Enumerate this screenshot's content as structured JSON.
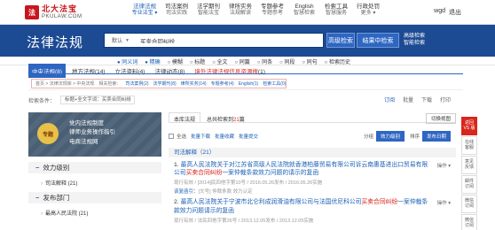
{
  "logo": {
    "mark": "法",
    "cn": "北大法宝",
    "en": "PKULAW.COM"
  },
  "nav": [
    {
      "label": "法律法规",
      "sub": "专业法宝 ▾",
      "active": true
    },
    {
      "label": "司法案例",
      "sub": "司法实践",
      "active": false
    },
    {
      "label": "法学期刊",
      "sub": "智能法宝",
      "active": false
    },
    {
      "label": "律所实务",
      "sub": "法规解读",
      "active": false
    },
    {
      "label": "专题参考",
      "sub": "专题参考",
      "active": false
    },
    {
      "label": "English",
      "sub": "智慧检索",
      "active": false
    },
    {
      "label": "检索工具",
      "sub": "智慧服务",
      "active": false
    },
    {
      "label": "行政处罚",
      "sub": "更多 ▾",
      "active": false
    }
  ],
  "user": "wgd",
  "logout": "退出",
  "banner": {
    "title": "法律法规",
    "scope": "默认",
    "query": "买卖合同纠纷",
    "search_btn": "高级检索",
    "insearch_btn": "结果中检索",
    "adv1": "高级检索",
    "adv2": "智能检索"
  },
  "subnav": [
    "● 同义词",
    "● 精确",
    "○ 模糊",
    "○ 标题",
    "○ 全文",
    "○ 同篇",
    "○ 同条",
    "○ 同段",
    "○ 同句",
    "○ 检索历史"
  ],
  "cats": [
    {
      "label": "中央法规",
      "count": "(8)",
      "on": true
    },
    {
      "label": "地方法规",
      "count": "(14)",
      "on": false
    },
    {
      "label": "立法资料",
      "count": "(4)",
      "on": false
    },
    {
      "label": "法律动态",
      "count": "(8)",
      "on": false
    },
    {
      "label": "境外法律法规信息资源搜",
      "count": "(1)",
      "on": false
    }
  ],
  "filter": {
    "crumb": "首页 > 法律法规库 > 中央法规",
    "related": "相关检索：",
    "links": [
      "司法案例(2)",
      "法学期刊(8)",
      "律所实务(14)",
      "专题参考(4)",
      "English(1)",
      "检索工具(0)"
    ]
  },
  "tools": [
    "订阅",
    "批量",
    "下载",
    "打印"
  ],
  "cond": {
    "label": "检索条件：",
    "value": "标题+全文字词：买卖合同纠纷",
    "clear": "×"
  },
  "promo": {
    "badge": "专题",
    "lines": [
      "党内法规制度",
      "律师业务操作指引",
      "电商法规网"
    ]
  },
  "sidebar": [
    {
      "head": "效力级别",
      "items": [
        "司法解释 (21)"
      ]
    },
    {
      "head": "发布部门",
      "items": [
        "最高人民法院 (21)"
      ]
    }
  ],
  "main": {
    "tab1": "本库法规",
    "tab2_prefix": "总共检索到",
    "tab2_count": "21",
    "tab2_suffix": "篇",
    "switch": "切换视图",
    "ops": [
      "全选",
      "批量下载",
      "批量收藏",
      "批量提交"
    ],
    "ops_right_label": "分组",
    "ops_pill1": "效力级别",
    "ops_sort": "排序",
    "ops_pill2": "发布日期",
    "group_label": "司法解释（21）",
    "items": [
      {
        "num": "1.",
        "text_a": "最高人民法院关于对江苏省高级人民法院就香港柏藤贸易有限公司诉云南惠基进出口贸易有限公司",
        "hl": "买卖合同纠纷",
        "text_b": "一案仲裁条款效力问题的请示的复函",
        "meta": "现行有效 / [2014]民四他字第10号 / 2016.05.26发布 / 2016.05.26实施",
        "rel": "该复函引：",
        "rel_b": "[文号] 仲裁条款 效力认定",
        "ops": "操作 ▾"
      },
      {
        "num": "2.",
        "text_a": "最高人民法院关于宁波市北仑利成润滑油有限公司与法国优尼科公司",
        "hl": "买卖合同纠纷",
        "text_b": "一案仲裁条款效力问题请示的复函",
        "meta": "现行有效 / 法民四他字第26号 / 2013.12.05发布 / 2013.12.05实施",
        "rel": "",
        "rel_b": "",
        "ops": "操作 ▾"
      }
    ]
  },
  "rbar": [
    "返回\nVS 版",
    "在线\n客服",
    "意见\n反馈",
    "邮件\n订阅",
    "微信\n订阅",
    "微信\n订阅"
  ],
  "colors": {
    "brand": "#1c4a93",
    "accent": "#2e66c2",
    "highlight": "#d9261c"
  }
}
